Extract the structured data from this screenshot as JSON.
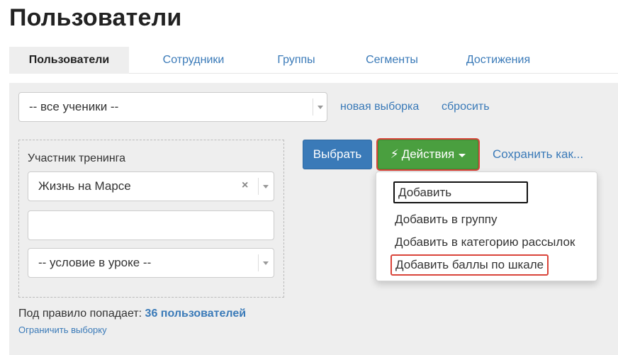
{
  "page": {
    "title": "Пользователи"
  },
  "tabs": [
    {
      "label": "Пользователи",
      "active": true
    },
    {
      "label": "Сотрудники",
      "active": false
    },
    {
      "label": "Группы",
      "active": false
    },
    {
      "label": "Сегменты",
      "active": false
    },
    {
      "label": "Достижения",
      "active": false
    }
  ],
  "filter": {
    "main_select_value": "-- все ученики --",
    "new_selection_link": "новая выборка",
    "reset_link": "сбросить"
  },
  "rule": {
    "label": "Участник тренинга",
    "training_value": "Жизнь на Марсе",
    "clear_icon": "×",
    "text_input_value": "",
    "condition_value": "-- условие в уроке --"
  },
  "toolbar": {
    "select_button": "Выбрать",
    "actions_button": "Действия",
    "bolt_icon": "⚡",
    "save_as_link": "Сохранить как..."
  },
  "actions_menu": {
    "items": [
      "Добавить",
      "Добавить в группу",
      "Добавить в категорию рассылок",
      "Добавить баллы по шкале"
    ]
  },
  "summary": {
    "prefix": "Под правило попадает:",
    "count": "36 пользователей",
    "limit_link": "Ограничить выборку"
  },
  "colors": {
    "link": "#3a7ab8",
    "primary_button": "#3a7ab8",
    "actions_button": "#4a9f3f",
    "highlight_border": "#d9443a",
    "panel_background": "#eeeeee"
  }
}
